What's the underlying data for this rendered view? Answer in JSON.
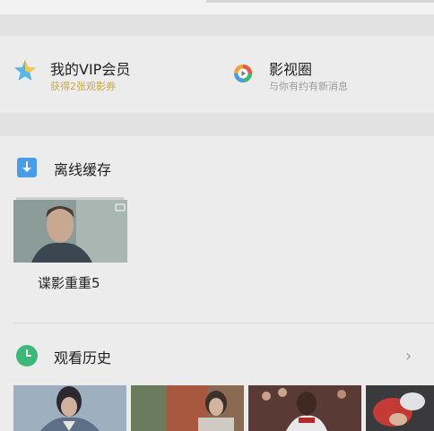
{
  "vip": {
    "title": "我的VIP会员",
    "subtitle": "获得2张观影券"
  },
  "circle": {
    "title": "影视圈",
    "subtitle": "与你有约有新消息"
  },
  "offline": {
    "title": "离线缓存",
    "videos": [
      {
        "label": "谍影重重5"
      }
    ]
  },
  "history": {
    "title": "观看历史"
  },
  "colors": {
    "vip_gold": "#c9a84b",
    "offline_blue": "#4a9ce8",
    "history_green": "#3db87a"
  }
}
